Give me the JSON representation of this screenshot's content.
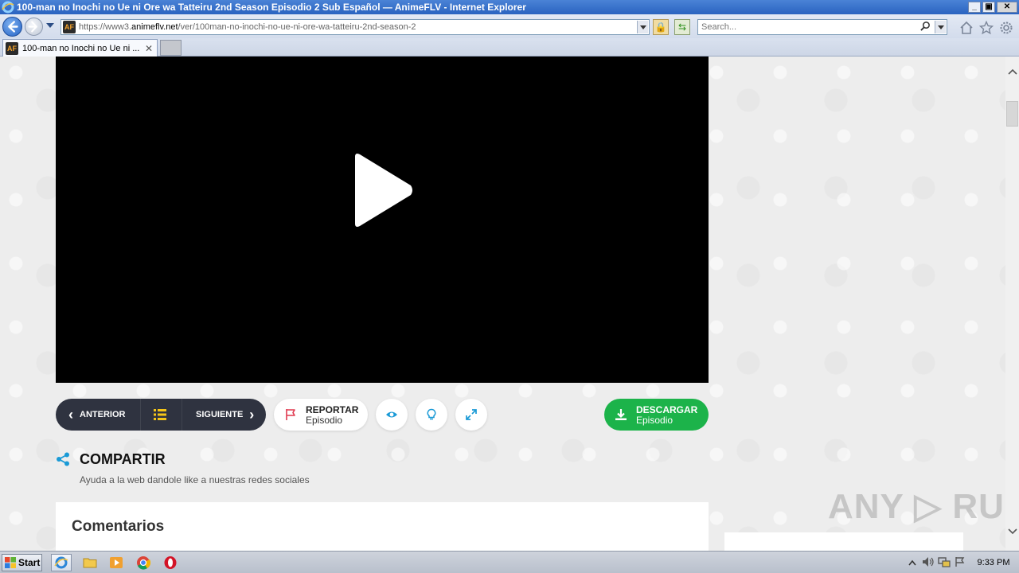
{
  "window": {
    "title": "100-man no Inochi no Ue ni Ore wa Tatteiru 2nd Season Episodio 2 Sub Español — AnimeFLV - Internet Explorer",
    "buttons": [
      "_",
      "▣",
      "✕"
    ]
  },
  "address_bar": {
    "favicon_text": "AF",
    "url_scheme": "https://www3.",
    "url_domain": "animeflv.net",
    "url_path": "/ver/100man-no-inochi-no-ue-ni-ore-wa-tatteiru-2nd-season-2",
    "lock_glyph": "🔒",
    "refresh_glyph": "⇆"
  },
  "search": {
    "placeholder": "Search...",
    "icon": "search-icon"
  },
  "toolbar_icons": [
    "home-icon",
    "favorites-star-icon",
    "settings-gear-icon"
  ],
  "tabs": [
    {
      "label": "100-man no Inochi no Ue ni ...",
      "favicon_text": "AF",
      "close": "✕"
    }
  ],
  "player": {
    "icon": "play-icon"
  },
  "episode_nav": {
    "prev_label": "ANTERIOR",
    "next_label": "SIGUIENTE",
    "prev_glyph": "‹",
    "next_glyph": "›",
    "list_icon": "list-icon"
  },
  "report": {
    "label_top": "REPORTAR",
    "label_bottom": "Episodio",
    "icon": "flag-icon"
  },
  "extra_buttons": [
    "eye-icon",
    "lightbulb-icon",
    "expand-icon"
  ],
  "download": {
    "label_top": "DESCARGAR",
    "label_bottom": "Episodio",
    "icon": "download-icon",
    "color": "#1cb34a"
  },
  "share": {
    "heading": "COMPARTIR",
    "subtitle": "Ayuda a la web dandole like a nuestras redes sociales",
    "icon_color": "#1a9ad6"
  },
  "comments": {
    "heading": "Comentarios"
  },
  "watermark": {
    "text": "ANY ▷ RUN"
  },
  "taskbar": {
    "start_label": "Start",
    "apps": [
      "internet-explorer-icon",
      "folder-icon",
      "media-player-icon",
      "chrome-icon",
      "opera-icon"
    ],
    "tray_icons": [
      "show-hidden-icons-icon",
      "volume-icon",
      "network-icon",
      "action-center-flag-icon"
    ],
    "clock": "9:33 PM"
  }
}
